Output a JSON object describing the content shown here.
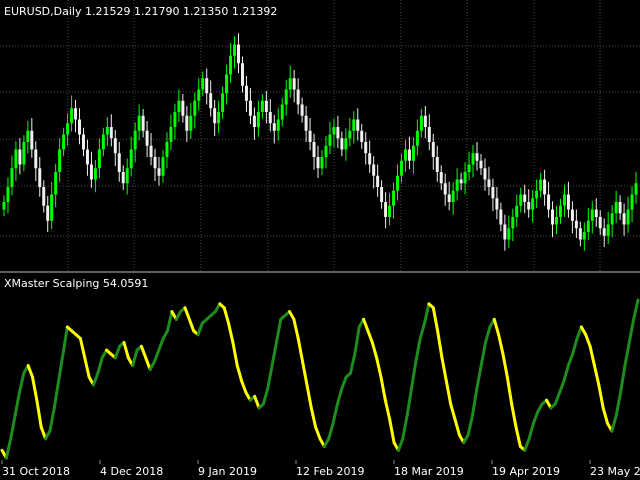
{
  "main_window": {
    "title": "EURUSD,Daily  1.21529 1.21790 1.21350 1.21392"
  },
  "indicator_window": {
    "title": "XMaster Scalping 54.0591"
  },
  "colors": {
    "background": "#000000",
    "bull_candle": "#00ff00",
    "bear_candle": "#f0f0f0",
    "indicator_up": "#1e8c1e",
    "indicator_down": "#ffff00",
    "grid": "#4a4a4a",
    "separator": "#bbbbbb",
    "text": "#ffffff"
  },
  "x_axis": {
    "labels": [
      "31 Oct 2018",
      "4 Dec 2018",
      "9 Jan 2019",
      "12 Feb 2019",
      "18 Mar 2019",
      "19 Apr 2019",
      "23 May 2019"
    ]
  },
  "chart_data": [
    {
      "type": "candlestick",
      "symbol": "EURUSD",
      "timeframe": "Daily",
      "last_ohlc": {
        "open": 1.21529,
        "high": 1.2179,
        "low": 1.2135,
        "close": 1.21392
      },
      "grid": true,
      "note": "price axis not shown; closes are the approximate close trajectory in price units",
      "closes": [
        1.172,
        1.176,
        1.181,
        1.186,
        1.182,
        1.188,
        1.191,
        1.186,
        1.181,
        1.176,
        1.171,
        1.167,
        1.174,
        1.18,
        1.186,
        1.19,
        1.193,
        1.197,
        1.194,
        1.19,
        1.186,
        1.182,
        1.178,
        1.181,
        1.186,
        1.19,
        1.192,
        1.189,
        1.185,
        1.18,
        1.177,
        1.181,
        1.186,
        1.191,
        1.195,
        1.191,
        1.187,
        1.184,
        1.181,
        1.179,
        1.184,
        1.188,
        1.192,
        1.196,
        1.199,
        1.195,
        1.191,
        1.195,
        1.199,
        1.202,
        1.205,
        1.201,
        1.197,
        1.193,
        1.196,
        1.201,
        1.206,
        1.211,
        1.214,
        1.209,
        1.203,
        1.199,
        1.195,
        1.192,
        1.196,
        1.199,
        1.196,
        1.193,
        1.191,
        1.194,
        1.198,
        1.202,
        1.205,
        1.202,
        1.198,
        1.195,
        1.191,
        1.188,
        1.184,
        1.181,
        1.184,
        1.187,
        1.19,
        1.192,
        1.189,
        1.186,
        1.189,
        1.191,
        1.194,
        1.191,
        1.188,
        1.185,
        1.182,
        1.179,
        1.176,
        1.172,
        1.168,
        1.171,
        1.175,
        1.179,
        1.183,
        1.186,
        1.183,
        1.187,
        1.191,
        1.195,
        1.192,
        1.188,
        1.184,
        1.18,
        1.177,
        1.174,
        1.172,
        1.175,
        1.178,
        1.177,
        1.18,
        1.182,
        1.185,
        1.183,
        1.181,
        1.178,
        1.176,
        1.173,
        1.17,
        1.166,
        1.162,
        1.165,
        1.168,
        1.171,
        1.174,
        1.172,
        1.17,
        1.173,
        1.175,
        1.178,
        1.174,
        1.17,
        1.166,
        1.168,
        1.171,
        1.174,
        1.17,
        1.167,
        1.165,
        1.162,
        1.164,
        1.167,
        1.17,
        1.168,
        1.165,
        1.163,
        1.166,
        1.169,
        1.172,
        1.169,
        1.166,
        1.17,
        1.174,
        1.177
      ]
    },
    {
      "type": "line",
      "name": "XMaster Scalping",
      "last_value": 54.0591,
      "grid": false,
      "note": "oscillator, green segments = rising, yellow segments = falling",
      "values": [
        22,
        18,
        28,
        40,
        52,
        62,
        66,
        60,
        48,
        34,
        28,
        32,
        44,
        58,
        72,
        86,
        84,
        82,
        80,
        70,
        60,
        56,
        62,
        70,
        74,
        72,
        70,
        76,
        78,
        70,
        66,
        74,
        76,
        70,
        64,
        68,
        74,
        80,
        84,
        94,
        90,
        94,
        96,
        90,
        84,
        82,
        88,
        90,
        92,
        94,
        98,
        96,
        88,
        78,
        66,
        58,
        52,
        48,
        50,
        44,
        46,
        54,
        66,
        78,
        90,
        92,
        94,
        90,
        80,
        68,
        56,
        44,
        34,
        28,
        24,
        28,
        36,
        46,
        54,
        60,
        62,
        72,
        86,
        90,
        84,
        78,
        70,
        60,
        48,
        38,
        26,
        22,
        28,
        40,
        54,
        68,
        80,
        88,
        98,
        96,
        84,
        70,
        58,
        46,
        38,
        30,
        26,
        30,
        40,
        54,
        66,
        78,
        86,
        90,
        82,
        72,
        60,
        46,
        34,
        24,
        22,
        28,
        36,
        42,
        46,
        48,
        44,
        46,
        52,
        58,
        66,
        72,
        80,
        86,
        82,
        76,
        66,
        56,
        44,
        36,
        32,
        40,
        52,
        66,
        78,
        90,
        100
      ]
    }
  ]
}
